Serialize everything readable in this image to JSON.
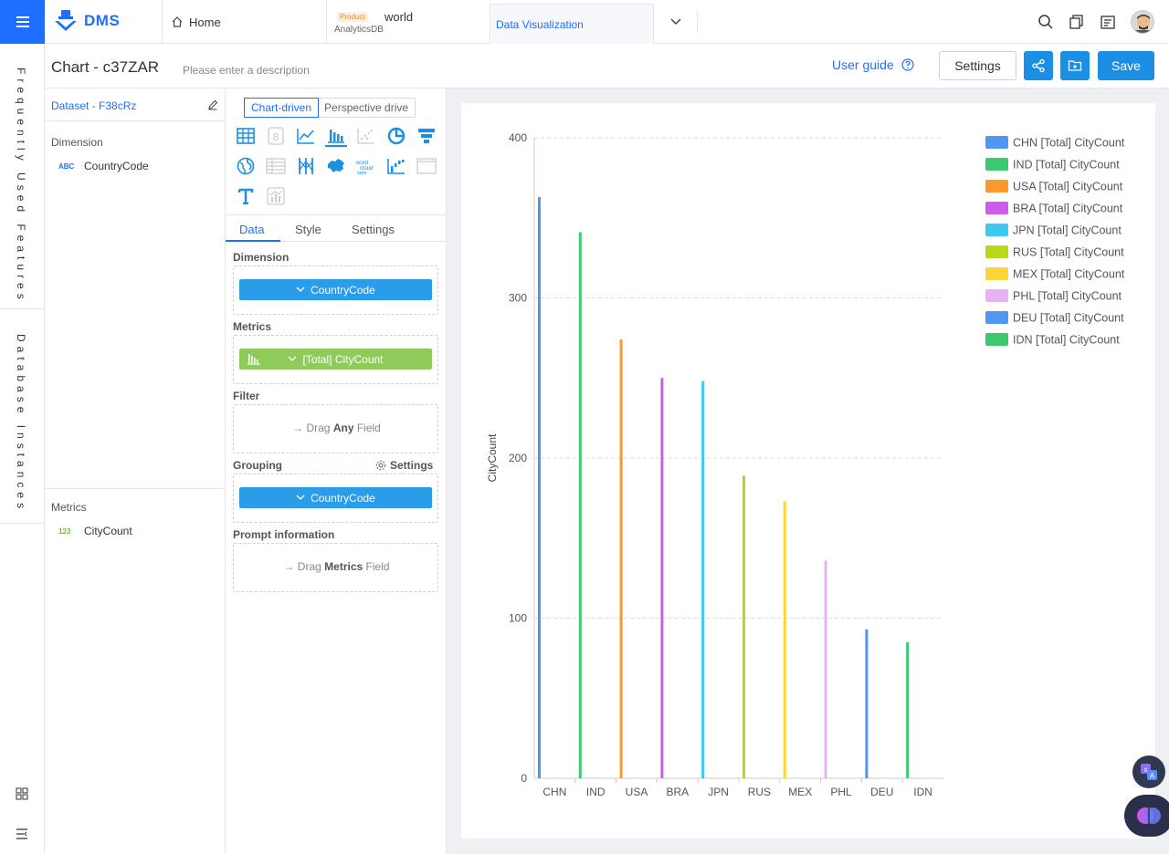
{
  "topbar": {
    "brand": "DMS",
    "tabs": {
      "home": "Home",
      "world_badge": "Product",
      "world_name": "world",
      "world_sub": "AnalyticsDB",
      "viz": "Data Visualization"
    }
  },
  "leftrail": {
    "frequent": "Frequently Used Features",
    "instances": "Database Instances"
  },
  "header": {
    "title": "Chart - c37ZAR",
    "description_placeholder": "Please enter a description",
    "user_guide": "User guide",
    "settings_label": "Settings",
    "save_label": "Save"
  },
  "fields": {
    "dataset": "Dataset - F38cRz",
    "dimension_label": "Dimension",
    "dimension_type": "ABC",
    "dimension_field": "CountryCode",
    "metrics_label": "Metrics",
    "metrics_type": "123",
    "metrics_field": "CityCount"
  },
  "config": {
    "mode_chart": "Chart-driven",
    "mode_perspective": "Perspective drive",
    "tabs": {
      "data": "Data",
      "style": "Style",
      "settings": "Settings"
    },
    "dimension_label": "Dimension",
    "dimension_pill": "CountryCode",
    "metrics_label": "Metrics",
    "metrics_pill": "[Total] CityCount",
    "filter_label": "Filter",
    "filter_drag_pre": "Drag",
    "filter_drag_bold": "Any",
    "filter_drag_post": "Field",
    "grouping_label": "Grouping",
    "grouping_settings": "Settings",
    "grouping_pill": "CountryCode",
    "prompt_label": "Prompt information",
    "prompt_drag_pre": "Drag",
    "prompt_drag_bold": "Metrics",
    "prompt_drag_post": "Field"
  },
  "colors": {
    "accent": "#1f6fff",
    "primary_button": "#1a8fe3"
  },
  "chart_data": {
    "type": "bar",
    "ylabel": "CityCount",
    "xlabel": "",
    "ylim": [
      0,
      400
    ],
    "yticks": [
      0,
      100,
      200,
      300,
      400
    ],
    "grid": true,
    "legend_position": "right",
    "categories": [
      "CHN",
      "IND",
      "USA",
      "BRA",
      "JPN",
      "RUS",
      "MEX",
      "PHL",
      "DEU",
      "IDN"
    ],
    "series": [
      {
        "name": "CHN [Total] CityCount",
        "category": "CHN",
        "value": 363,
        "color": "#4f97f2"
      },
      {
        "name": "IND [Total] CityCount",
        "category": "IND",
        "value": 341,
        "color": "#3dc96d"
      },
      {
        "name": "USA [Total] CityCount",
        "category": "USA",
        "value": 274,
        "color": "#fb9a2a"
      },
      {
        "name": "BRA [Total] CityCount",
        "category": "BRA",
        "value": 250,
        "color": "#cc5cec"
      },
      {
        "name": "JPN [Total] CityCount",
        "category": "JPN",
        "value": 248,
        "color": "#3dc8f0"
      },
      {
        "name": "RUS [Total] CityCount",
        "category": "RUS",
        "value": 189,
        "color": "#b6d91a"
      },
      {
        "name": "MEX [Total] CityCount",
        "category": "MEX",
        "value": 173,
        "color": "#fdd43a"
      },
      {
        "name": "PHL [Total] CityCount",
        "category": "PHL",
        "value": 136,
        "color": "#e7b2f2"
      },
      {
        "name": "DEU [Total] CityCount",
        "category": "DEU",
        "value": 93,
        "color": "#4f97f2"
      },
      {
        "name": "IDN [Total] CityCount",
        "category": "IDN",
        "value": 85,
        "color": "#3dc96d"
      }
    ]
  }
}
